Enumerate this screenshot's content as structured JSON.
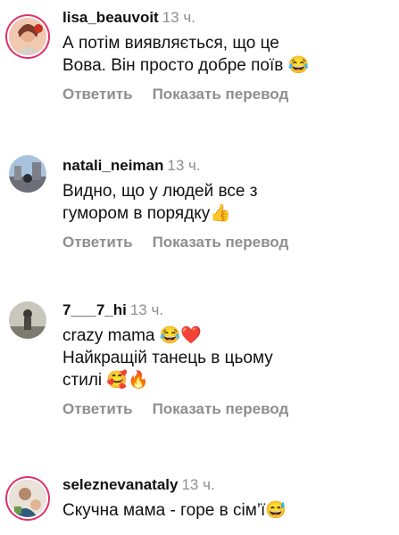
{
  "comments": [
    {
      "username": "lisa_beauvoit",
      "time": "13 ч.",
      "lines": [
        "А потім виявляється, що це",
        "Вова. Він просто добре поїв 😂"
      ],
      "reply": "Ответить",
      "translate": "Показать перевод",
      "avatar_icon": "user-photo",
      "has_story_ring": true
    },
    {
      "username": "natali_neiman",
      "time": "13 ч.",
      "lines": [
        "Видно, що у людей все з",
        "гумором в порядку👍"
      ],
      "reply": "Ответить",
      "translate": "Показать перевод",
      "avatar_icon": "user-photo",
      "has_story_ring": false
    },
    {
      "username": "7___7_hi",
      "time": "13 ч.",
      "lines": [
        "crazy mama 😂❤️",
        "Найкращій танець в цьому",
        "стилі 🥰🔥"
      ],
      "reply": "Ответить",
      "translate": "Показать перевод",
      "avatar_icon": "user-photo",
      "has_story_ring": false
    },
    {
      "username": "seleznevanataly",
      "time": "13 ч.",
      "lines": [
        "Скучна мама - горе в сім’ї😅"
      ],
      "reply": "",
      "translate": "",
      "avatar_icon": "user-photo",
      "has_story_ring": true
    }
  ],
  "colors": {
    "text": "#111111",
    "muted": "#8e8e8e",
    "ring": "#e1306c"
  }
}
